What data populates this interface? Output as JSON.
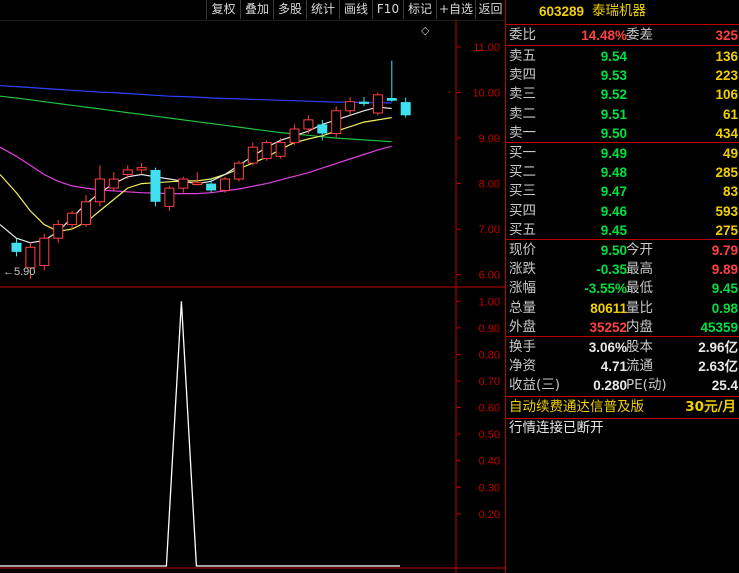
{
  "toolbar": {
    "buttons": [
      "复权",
      "叠加",
      "多股",
      "统计",
      "画线",
      "F10",
      "标记",
      "+自选",
      "返回"
    ]
  },
  "chart": {
    "price_ticks": [
      "11.00",
      "10.00",
      "9.00",
      "8.00",
      "7.00",
      "6.00"
    ],
    "indicator_ticks": [
      "1.00",
      "0.90",
      "0.80",
      "0.70",
      "0.60",
      "0.50",
      "0.40",
      "0.30",
      "0.20"
    ],
    "low_marker": "5.90",
    "corner_glyph": "◇"
  },
  "chart_data": {
    "type": "candlestick",
    "price_ylim": [
      5.75,
      11.55
    ],
    "indicator_ylim": [
      0,
      1.05
    ],
    "candles": [
      {
        "o": 6.7,
        "c": 6.5,
        "h": 6.8,
        "l": 6.4
      },
      {
        "o": 6.15,
        "c": 6.6,
        "h": 6.7,
        "l": 5.9
      },
      {
        "o": 6.2,
        "c": 6.8,
        "h": 6.9,
        "l": 6.1
      },
      {
        "o": 6.8,
        "c": 7.1,
        "h": 7.2,
        "l": 6.7
      },
      {
        "o": 7.1,
        "c": 7.35,
        "h": 7.4,
        "l": 7.0
      },
      {
        "o": 7.1,
        "c": 7.6,
        "h": 7.75,
        "l": 7.05
      },
      {
        "o": 7.6,
        "c": 8.1,
        "h": 8.4,
        "l": 7.5
      },
      {
        "o": 7.9,
        "c": 8.1,
        "h": 8.25,
        "l": 7.85
      },
      {
        "o": 8.2,
        "c": 8.3,
        "h": 8.4,
        "l": 8.1
      },
      {
        "o": 8.3,
        "c": 8.35,
        "h": 8.45,
        "l": 8.2
      },
      {
        "o": 8.3,
        "c": 7.6,
        "h": 8.35,
        "l": 7.5
      },
      {
        "o": 7.5,
        "c": 7.9,
        "h": 7.95,
        "l": 7.4
      },
      {
        "o": 7.9,
        "c": 8.1,
        "h": 8.15,
        "l": 7.8
      },
      {
        "o": 7.98,
        "c": 8.02,
        "h": 8.25,
        "l": 7.95
      },
      {
        "o": 8.0,
        "c": 7.85,
        "h": 8.1,
        "l": 7.8
      },
      {
        "o": 7.85,
        "c": 8.1,
        "h": 8.15,
        "l": 7.8
      },
      {
        "o": 8.1,
        "c": 8.45,
        "h": 8.5,
        "l": 8.05
      },
      {
        "o": 8.45,
        "c": 8.8,
        "h": 8.9,
        "l": 8.4
      },
      {
        "o": 8.55,
        "c": 8.9,
        "h": 8.95,
        "l": 8.5
      },
      {
        "o": 8.6,
        "c": 8.9,
        "h": 9.0,
        "l": 8.55
      },
      {
        "o": 8.9,
        "c": 9.2,
        "h": 9.3,
        "l": 8.85
      },
      {
        "o": 9.2,
        "c": 9.4,
        "h": 9.5,
        "l": 9.1
      },
      {
        "o": 9.3,
        "c": 9.1,
        "h": 9.4,
        "l": 8.95
      },
      {
        "o": 9.1,
        "c": 9.6,
        "h": 9.7,
        "l": 9.0
      },
      {
        "o": 9.6,
        "c": 9.8,
        "h": 9.9,
        "l": 9.5
      },
      {
        "o": 9.8,
        "c": 9.75,
        "h": 9.9,
        "l": 9.7
      },
      {
        "o": 9.55,
        "c": 9.95,
        "h": 10.0,
        "l": 9.5
      },
      {
        "o": 9.88,
        "c": 9.82,
        "h": 10.7,
        "l": 9.8
      },
      {
        "o": 9.79,
        "c": 9.5,
        "h": 9.89,
        "l": 9.45
      }
    ],
    "ma_blue": [
      10.15,
      10.13,
      10.11,
      10.09,
      10.07,
      10.05,
      10.03,
      10.01,
      10.0,
      9.98,
      9.96,
      9.94,
      9.92,
      9.91,
      9.9,
      9.88,
      9.87,
      9.86,
      9.85,
      9.84,
      9.83,
      9.82,
      9.81,
      9.8,
      9.79,
      9.79,
      9.78,
      9.78,
      9.77
    ],
    "ma_green": [
      9.92,
      9.88,
      9.84,
      9.8,
      9.76,
      9.72,
      9.68,
      9.64,
      9.6,
      9.56,
      9.52,
      9.48,
      9.44,
      9.4,
      9.36,
      9.32,
      9.28,
      9.24,
      9.2,
      9.16,
      9.12,
      9.09,
      9.06,
      9.03,
      9.0,
      8.98,
      8.96,
      8.94,
      8.92
    ],
    "ma_magenta": [
      8.8,
      8.6,
      8.4,
      8.2,
      8.05,
      7.95,
      7.9,
      7.86,
      7.84,
      7.82,
      7.8,
      7.79,
      7.78,
      7.78,
      7.78,
      7.8,
      7.84,
      7.88,
      7.94,
      8.0,
      8.08,
      8.16,
      8.24,
      8.34,
      8.44,
      8.54,
      8.64,
      8.74,
      8.82
    ],
    "ma_yellow": [
      8.2,
      7.8,
      7.4,
      7.1,
      6.95,
      7.0,
      7.15,
      7.4,
      7.65,
      7.9,
      8.0,
      8.02,
      8.04,
      8.06,
      8.06,
      8.1,
      8.2,
      8.32,
      8.45,
      8.58,
      8.75,
      8.9,
      8.98,
      9.05,
      9.15,
      9.25,
      9.35,
      9.4,
      9.45
    ],
    "ma_white": [
      7.1,
      6.8,
      6.7,
      6.75,
      6.95,
      7.25,
      7.55,
      7.8,
      8.0,
      8.15,
      8.2,
      8.15,
      8.1,
      8.05,
      8.0,
      8.05,
      8.2,
      8.4,
      8.6,
      8.8,
      8.95,
      9.05,
      9.15,
      9.3,
      9.4,
      9.5,
      9.6,
      9.68,
      9.65
    ],
    "indicator_peak": {
      "index": 11,
      "value": 1.0
    }
  },
  "panel": {
    "header": {
      "code": "603289",
      "name": "泰瑞机器"
    },
    "weibi": {
      "label": "委比",
      "value": "14.48%",
      "label2": "委差",
      "value2": "325"
    },
    "sell": [
      {
        "label": "卖五",
        "price": "9.54",
        "vol": "136"
      },
      {
        "label": "卖四",
        "price": "9.53",
        "vol": "223"
      },
      {
        "label": "卖三",
        "price": "9.52",
        "vol": "106"
      },
      {
        "label": "卖二",
        "price": "9.51",
        "vol": "61"
      },
      {
        "label": "卖一",
        "price": "9.50",
        "vol": "434"
      }
    ],
    "buy": [
      {
        "label": "买一",
        "price": "9.49",
        "vol": "49"
      },
      {
        "label": "买二",
        "price": "9.48",
        "vol": "285"
      },
      {
        "label": "买三",
        "price": "9.47",
        "vol": "83"
      },
      {
        "label": "买四",
        "price": "9.46",
        "vol": "593"
      },
      {
        "label": "买五",
        "price": "9.45",
        "vol": "275"
      }
    ],
    "quote": [
      {
        "l1": "现价",
        "v1": "9.50",
        "c1": "grn",
        "l2": "今开",
        "v2": "9.79",
        "c2": "red"
      },
      {
        "l1": "涨跌",
        "v1": "-0.35",
        "c1": "grn",
        "l2": "最高",
        "v2": "9.89",
        "c2": "red"
      },
      {
        "l1": "涨幅",
        "v1": "-3.55%",
        "c1": "grn",
        "l2": "最低",
        "v2": "9.45",
        "c2": "grn"
      },
      {
        "l1": "总量",
        "v1": "80611",
        "c1": "yel",
        "l2": "量比",
        "v2": "0.98",
        "c2": "grn"
      },
      {
        "l1": "外盘",
        "v1": "35252",
        "c1": "red",
        "l2": "内盘",
        "v2": "45359",
        "c2": "grn"
      }
    ],
    "stats": [
      {
        "l1": "换手",
        "v1": "3.06%",
        "l2": "股本",
        "v2": "2.96亿"
      },
      {
        "l1": "净资",
        "v1": "4.71",
        "l2": "流通",
        "v2": "2.63亿"
      },
      {
        "l1": "收益(三)",
        "v1": "0.280",
        "l2": "PE(动)",
        "v2": "25.4"
      }
    ],
    "promo": {
      "text": "自动续费通达信普及版",
      "price": "30元/月"
    },
    "status": "行情连接已断开"
  },
  "colors": {
    "up": "#ff4040",
    "down": "#40e0f0",
    "frame": "#c00000",
    "blue_ma": "#3040ff",
    "green_ma": "#20c040",
    "magenta_ma": "#e040e0",
    "yellow_ma": "#f0f060",
    "white_ma": "#e8e8e8"
  }
}
